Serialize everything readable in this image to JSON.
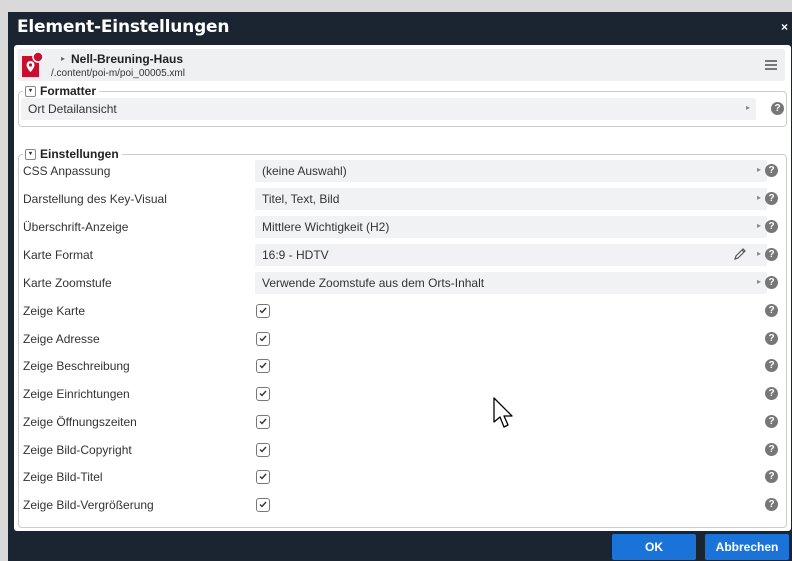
{
  "dialog": {
    "title": "Element-Einstellungen",
    "close_symbol": "×"
  },
  "resource": {
    "arrow_symbol": "▸",
    "title": "Nell-Breuning-Haus",
    "path": "/.content/poi-m/poi_00005.xml",
    "icon": "map-pin-icon"
  },
  "formatter": {
    "legend": "Formatter",
    "toggle_symbol": "▾",
    "value": "Ort Detailansicht"
  },
  "settings": {
    "legend": "Einstellungen",
    "toggle_symbol": "▾",
    "selects": [
      {
        "label": "CSS Anpassung",
        "value": "(keine Auswahl)",
        "editable": false
      },
      {
        "label": "Darstellung des Key-Visual",
        "value": "Titel, Text, Bild",
        "editable": false
      },
      {
        "label": "Überschrift-Anzeige",
        "value": "Mittlere Wichtigkeit (H2)",
        "editable": false
      },
      {
        "label": "Karte Format",
        "value": "16:9 - HDTV",
        "editable": true
      },
      {
        "label": "Karte Zoomstufe",
        "value": "Verwende Zoomstufe aus dem Orts-Inhalt",
        "editable": false
      }
    ],
    "checkboxes": [
      {
        "label": "Zeige Karte",
        "checked": true
      },
      {
        "label": "Zeige Adresse",
        "checked": true
      },
      {
        "label": "Zeige Beschreibung",
        "checked": true
      },
      {
        "label": "Zeige Einrichtungen",
        "checked": true
      },
      {
        "label": "Zeige Öffnungszeiten",
        "checked": true
      },
      {
        "label": "Zeige Bild-Copyright",
        "checked": true
      },
      {
        "label": "Zeige Bild-Titel",
        "checked": true
      },
      {
        "label": "Zeige Bild-Vergrößerung",
        "checked": true
      }
    ]
  },
  "help_symbol": "?",
  "chevron_symbol": "▸",
  "buttons": {
    "ok": "OK",
    "cancel": "Abbrechen"
  },
  "colors": {
    "titlebar": "#1b2431",
    "button": "#1a73d9",
    "pin": "#c8102e"
  }
}
